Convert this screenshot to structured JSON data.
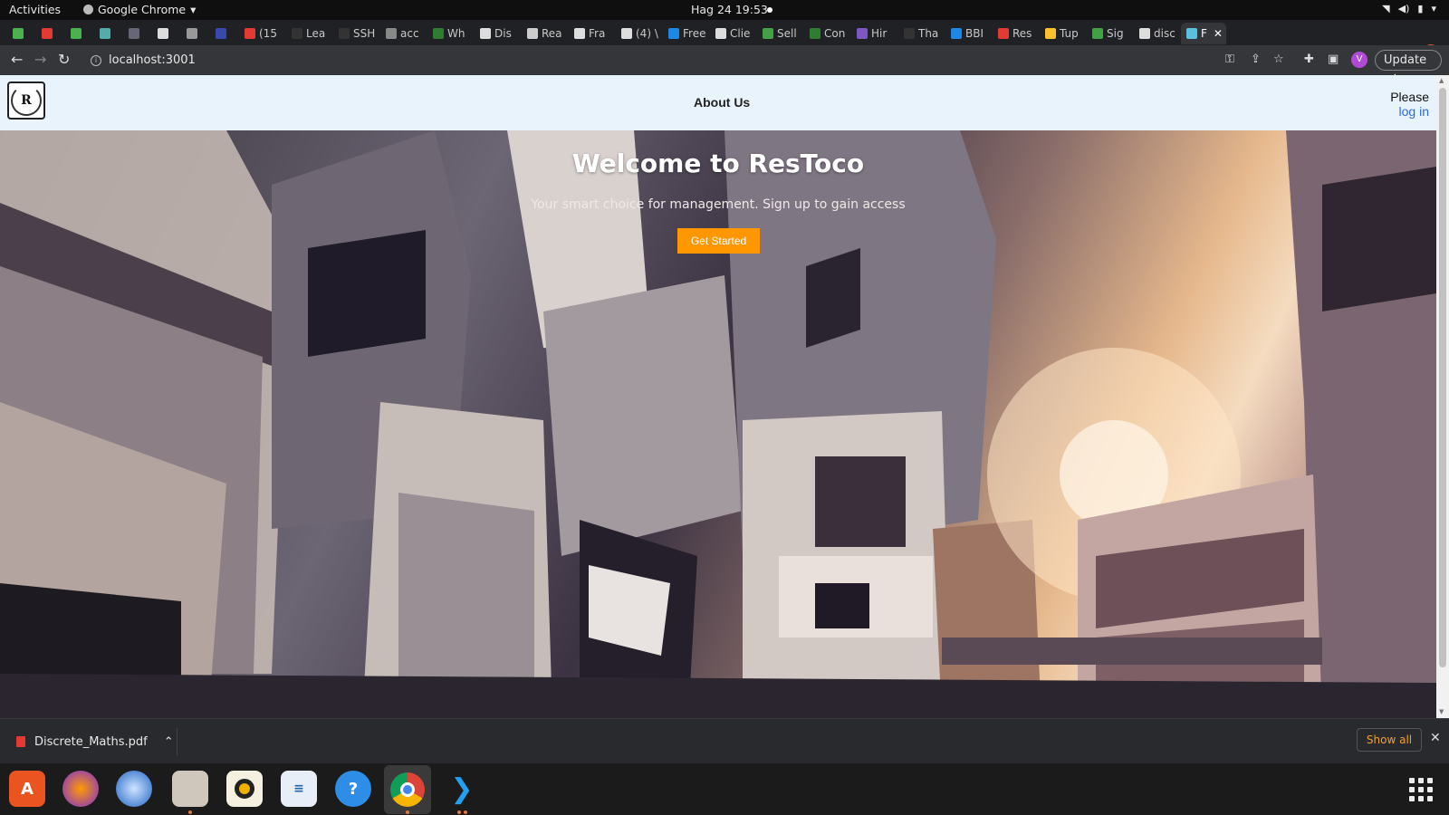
{
  "system": {
    "activities": "Activities",
    "app_name": "Google Chrome",
    "clock": "Hag 24  19:53"
  },
  "browser": {
    "tabs": [
      {
        "label": "",
        "fav": "#4caf50"
      },
      {
        "label": "",
        "fav": "#e53935"
      },
      {
        "label": "",
        "fav": "#4caf50"
      },
      {
        "label": "",
        "fav": "#5aa"
      },
      {
        "label": "",
        "fav": "#667"
      },
      {
        "label": "",
        "fav": "#ddd"
      },
      {
        "label": "",
        "fav": "#999"
      },
      {
        "label": "",
        "fav": "#3949ab"
      },
      {
        "label": "(15",
        "fav": "#e53935"
      },
      {
        "label": "Lea",
        "fav": "#333"
      },
      {
        "label": "SSH",
        "fav": "#333"
      },
      {
        "label": "acc",
        "fav": "#888"
      },
      {
        "label": "Wh",
        "fav": "#2e7d32"
      },
      {
        "label": "Dis",
        "fav": "#ddd"
      },
      {
        "label": "Rea",
        "fav": "#ccc"
      },
      {
        "label": "Fra",
        "fav": "#ddd"
      },
      {
        "label": "(4) \\",
        "fav": "#ddd"
      },
      {
        "label": "Free",
        "fav": "#1e88e5"
      },
      {
        "label": "Clie",
        "fav": "#ddd"
      },
      {
        "label": "Sell",
        "fav": "#43a047"
      },
      {
        "label": "Con",
        "fav": "#2e7d32"
      },
      {
        "label": "Hir",
        "fav": "#7e57c2"
      },
      {
        "label": "Tha",
        "fav": "#333"
      },
      {
        "label": "BBI",
        "fav": "#1e88e5"
      },
      {
        "label": "Res",
        "fav": "#e53935"
      },
      {
        "label": "Tup",
        "fav": "#fbc02d"
      },
      {
        "label": "Sig",
        "fav": "#43a047"
      },
      {
        "label": "disc",
        "fav": "#ddd"
      },
      {
        "label": "F",
        "fav": "#5bc0de",
        "active": true
      }
    ],
    "url": "localhost:3001",
    "profile_initial": "V",
    "update_label": "Update"
  },
  "site": {
    "logo_letter": "R",
    "nav_about": "About Us",
    "login_prompt": "Please",
    "login_link": "log in",
    "hero_title": "Welcome to ResToco",
    "hero_subtitle": "Your smart choice for management. Sign up to gain access",
    "cta_label": "Get Started"
  },
  "downloads": {
    "file_name": "Discrete_Maths.pdf",
    "show_all": "Show all"
  },
  "dock": {
    "apps": [
      "app-center-icon",
      "firefox-icon",
      "thunderbird-icon",
      "files-icon",
      "rhythmbox-icon",
      "writer-icon",
      "help-icon",
      "chrome-icon",
      "vscode-icon"
    ]
  }
}
